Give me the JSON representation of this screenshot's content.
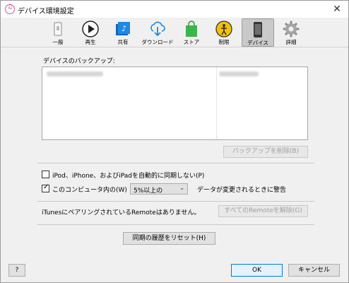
{
  "window": {
    "title": "デバイス環境設定",
    "close_glyph": "✕"
  },
  "toolbar": {
    "items": [
      {
        "label": "一般",
        "icon": "switch-icon"
      },
      {
        "label": "再生",
        "icon": "play-icon"
      },
      {
        "label": "共有",
        "icon": "music-folder-icon"
      },
      {
        "label": "ダウンロード",
        "icon": "cloud-download-icon"
      },
      {
        "label": "ストア",
        "icon": "shopping-bag-icon"
      },
      {
        "label": "制限",
        "icon": "parental-control-icon"
      },
      {
        "label": "デバイス",
        "icon": "iphone-icon",
        "selected": true
      },
      {
        "label": "詳細",
        "icon": "gear-icon"
      }
    ]
  },
  "backups": {
    "label": "デバイスのバックアップ:",
    "delete_button": "バックアップを削除(B)"
  },
  "options": {
    "prevent_sync": {
      "label": "iPod、iPhone、およびiPadを自動的に同期しない(P)",
      "checked": false
    },
    "warn_when": {
      "label": "このコンピュータ内の(W)",
      "checked": true
    },
    "percent_select": {
      "value": "5%以上の"
    },
    "warn_suffix": "データが変更されるときに警告"
  },
  "remote": {
    "status": "iTunesにペアリングされているRemoteはありません。",
    "forget_button": "すべてのRemoteを解除(G)"
  },
  "reset_sync_history_button": "同期の履歴をリセット(H)",
  "footer": {
    "help": "?",
    "ok": "OK",
    "cancel": "キャンセル"
  },
  "colors": {
    "selected_tab": "#c9c9c9",
    "primary_border": "#0078d7",
    "store_green": "#3cb44a",
    "restrict_yellow": "#f2c200",
    "music_blue": "#1e88e5"
  }
}
